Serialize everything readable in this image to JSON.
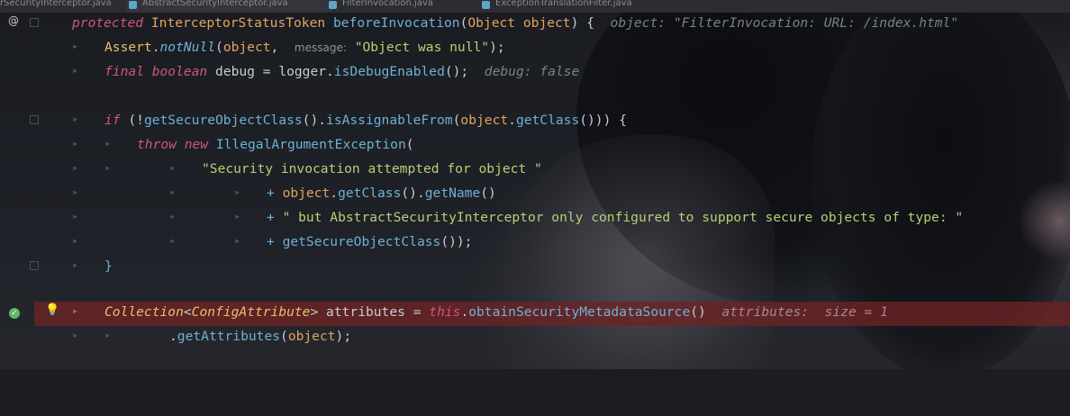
{
  "tabs": [
    {
      "label": "rSecurityInterceptor.java",
      "active": false
    },
    {
      "label": "AbstractSecurityInterceptor.java",
      "active": true
    },
    {
      "label": "FilterInvocation.java",
      "active": false
    },
    {
      "label": "ExceptionTranslationFilter.java",
      "active": false
    }
  ],
  "code": {
    "l1": {
      "kw": "protected",
      "type": "InterceptorStatusToken",
      "method": "beforeInvocation",
      "open": "(",
      "ptype": "Object",
      "pname": "object",
      "close": ") {",
      "inline": "object: \"FilterInvocation: URL: /index.html\""
    },
    "l2": {
      "cls": "Assert",
      "dot": ".",
      "method": "notNull",
      "open": "(",
      "arg": "object",
      "comma": ",",
      "hint": "message:",
      "str": "\"Object was null\"",
      "close": ");"
    },
    "l3": {
      "kw": "final boolean",
      "var": "debug",
      "eq": " = ",
      "obj": "logger",
      "dot": ".",
      "method": "isDebugEnabled",
      "close": "();",
      "inline": "debug: false"
    },
    "l5": {
      "kw": "if",
      "open": " (!",
      "m1": "getSecureObjectClass",
      "p1": "().",
      "m2": "isAssignableFrom",
      "p2": "(",
      "arg": "object",
      "dot": ".",
      "m3": "getClass",
      "close": "())) {"
    },
    "l6": {
      "kw": "throw new",
      "cls": "IllegalArgumentException",
      "open": "("
    },
    "l7": {
      "str": "\"Security invocation attempted for object \""
    },
    "l8": {
      "plus": "+ ",
      "obj": "object",
      "dot": ".",
      "m1": "getClass",
      "p1": "().",
      "m2": "getName",
      "close": "()"
    },
    "l9": {
      "plus": "+ ",
      "str": "\" but AbstractSecurityInterceptor only configured to support secure objects of type: \""
    },
    "l10": {
      "plus": "+ ",
      "method": "getSecureObjectClass",
      "close": "());"
    },
    "l11": {
      "brace": "}"
    },
    "l13": {
      "t1": "Collection",
      "lt": "<",
      "t2": "ConfigAttribute",
      "gt": ">",
      "var": " attributes = ",
      "kw": "this",
      "dot": ".",
      "method": "obtainSecurityMetadataSource",
      "close": "()",
      "inline": "attributes:  size = 1"
    },
    "l14": {
      "dot": ".",
      "method": "getAttributes",
      "open": "(",
      "arg": "object",
      "close": ");"
    }
  },
  "icons": {
    "override": "@",
    "breakpoint_check": "✓",
    "intention_bulb": "💡"
  }
}
